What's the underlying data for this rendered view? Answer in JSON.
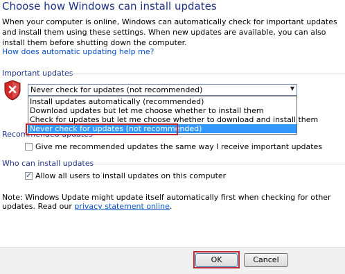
{
  "header": {
    "title": "Choose how Windows can install updates",
    "intro": "When your computer is online, Windows can automatically check for important updates and install them using these settings. When new updates are available, you can also install them before shutting down the computer.",
    "help_link": "How does automatic updating help me?"
  },
  "important_updates": {
    "label": "Important updates",
    "icon": "shield-error-icon",
    "selected": "Never check for updates (not recommended)",
    "options": [
      "Install updates automatically (recommended)",
      "Download updates but let me choose whether to install them",
      "Check for updates but let me choose whether to download and install them",
      "Never check for updates (not recommended)"
    ],
    "highlight_color": "#c02838"
  },
  "recommended_updates": {
    "label": "Recommended updates",
    "checkbox_label": "Give me recommended updates the same way I receive important updates",
    "checked": false
  },
  "who_can_install": {
    "label": "Who can install updates",
    "checkbox_label": "Allow all users to install updates on this computer",
    "checked": true
  },
  "note": {
    "text": "Note: Windows Update might update itself automatically first when checking for other updates.  Read our ",
    "link": "privacy statement online",
    "after": "."
  },
  "buttons": {
    "ok": "OK",
    "cancel": "Cancel"
  }
}
